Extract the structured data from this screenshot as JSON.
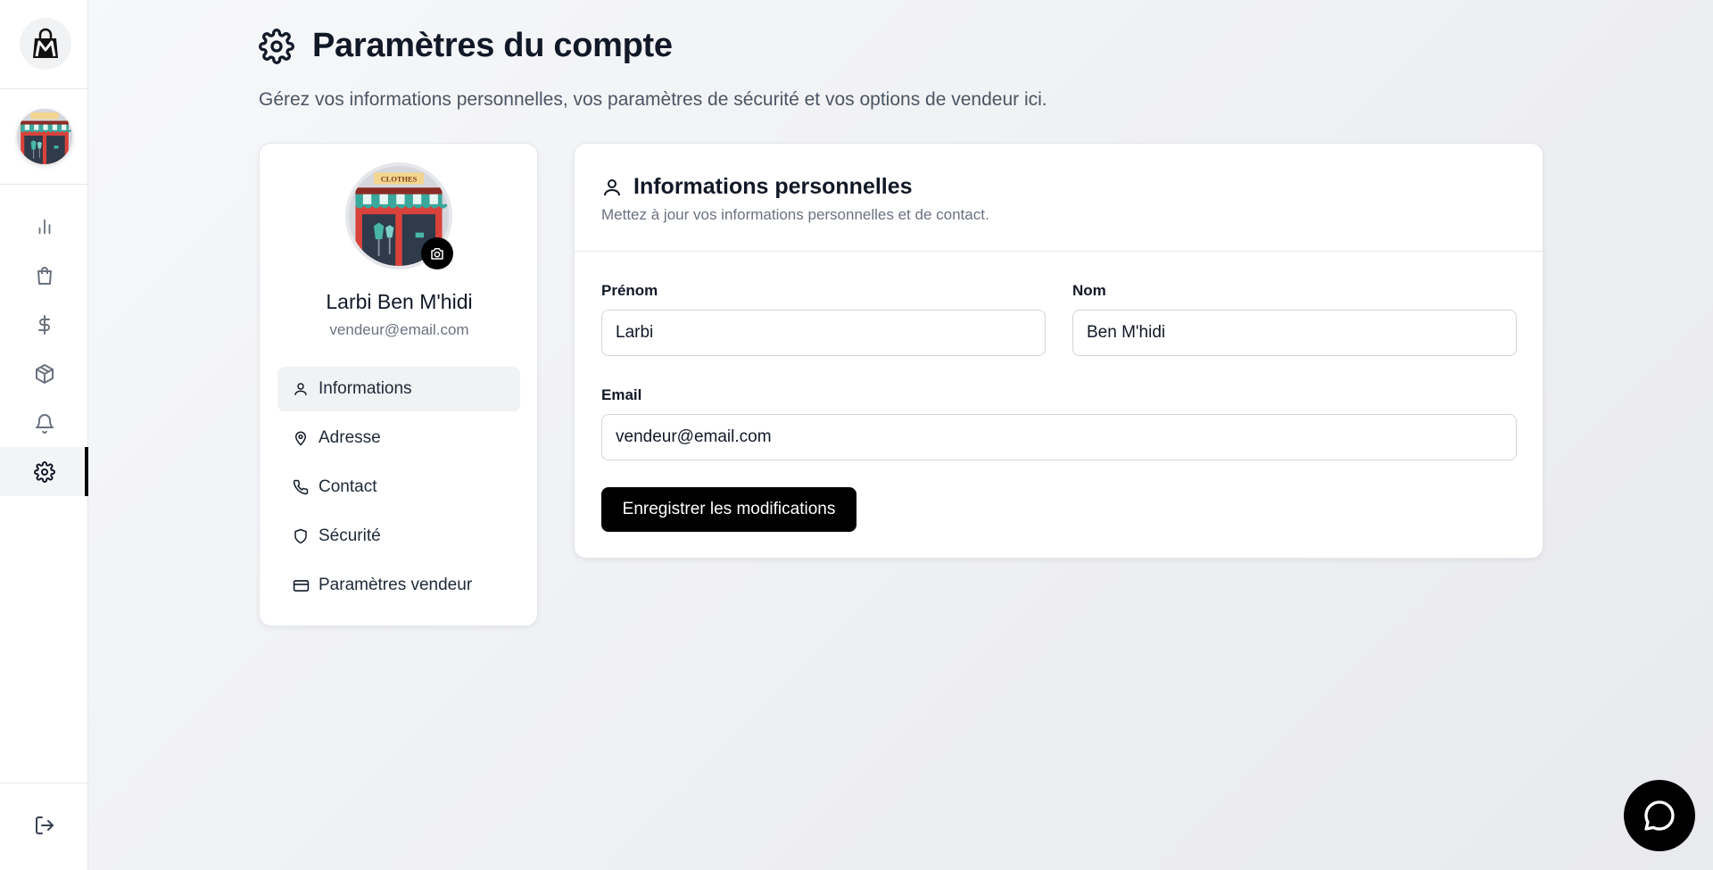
{
  "header": {
    "title": "Paramètres du compte",
    "subtitle": "Gérez vos informations personnelles, vos paramètres de sécurité et vos options de vendeur ici."
  },
  "sidebar": {
    "logo_icon": "shopping-bag-logo-icon",
    "store_avatar": "clothes-store-icon",
    "items": [
      {
        "name": "analytics",
        "icon": "bar-chart-icon"
      },
      {
        "name": "orders",
        "icon": "shopping-bag-icon"
      },
      {
        "name": "finance",
        "icon": "dollar-icon"
      },
      {
        "name": "products",
        "icon": "box-icon"
      },
      {
        "name": "notifications",
        "icon": "bell-icon"
      },
      {
        "name": "settings",
        "icon": "gear-icon",
        "active": true
      }
    ],
    "logout_icon": "logout-icon"
  },
  "profile": {
    "name": "Larbi Ben M'hidi",
    "email": "vendeur@email.com",
    "avatar_sign": "CLOTHES",
    "menu": [
      {
        "label": "Informations",
        "icon": "user-icon",
        "active": true
      },
      {
        "label": "Adresse",
        "icon": "map-pin-icon"
      },
      {
        "label": "Contact",
        "icon": "phone-icon"
      },
      {
        "label": "Sécurité",
        "icon": "shield-icon"
      },
      {
        "label": "Paramètres vendeur",
        "icon": "credit-card-icon"
      }
    ]
  },
  "info": {
    "title": "Informations personnelles",
    "subtitle": "Mettez à jour vos informations personnelles et de contact.",
    "fields": {
      "first_name": {
        "label": "Prénom",
        "value": "Larbi"
      },
      "last_name": {
        "label": "Nom",
        "value": "Ben M'hidi"
      },
      "email": {
        "label": "Email",
        "value": "vendeur@email.com"
      }
    },
    "save_label": "Enregistrer les modifications"
  },
  "chat": {
    "icon": "chat-bubble-icon"
  },
  "colors": {
    "accent": "#000000",
    "background": "#f3f4f6",
    "text": "#111827",
    "muted": "#6b7280"
  }
}
